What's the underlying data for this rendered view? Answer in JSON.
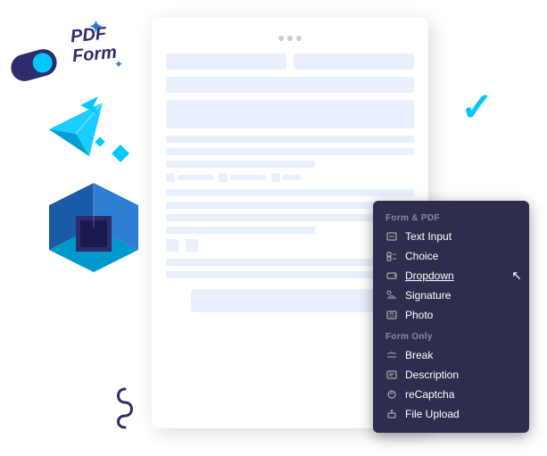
{
  "document": {
    "browser_dots": [
      "dot1",
      "dot2",
      "dot3"
    ]
  },
  "pdf_label": {
    "line1": "PDF",
    "line2": "Form"
  },
  "context_menu": {
    "section1": {
      "header": "Form & PDF",
      "items": [
        {
          "id": "text-input",
          "label": "Text Input",
          "icon": "text-input-icon"
        },
        {
          "id": "choice",
          "label": "Choice",
          "icon": "choice-icon"
        },
        {
          "id": "dropdown",
          "label": "Dropdown",
          "icon": "dropdown-icon",
          "active": true
        },
        {
          "id": "signature",
          "label": "Signature",
          "icon": "signature-icon"
        },
        {
          "id": "photo",
          "label": "Photo",
          "icon": "photo-icon"
        }
      ]
    },
    "section2": {
      "header": "Form Only",
      "items": [
        {
          "id": "break",
          "label": "Break",
          "icon": "break-icon"
        },
        {
          "id": "description",
          "label": "Description",
          "icon": "description-icon"
        },
        {
          "id": "recaptcha",
          "label": "reCaptcha",
          "icon": "recaptcha-icon"
        },
        {
          "id": "file-upload",
          "label": "File Upload",
          "icon": "file-upload-icon"
        }
      ]
    }
  },
  "checkmark": "✓"
}
